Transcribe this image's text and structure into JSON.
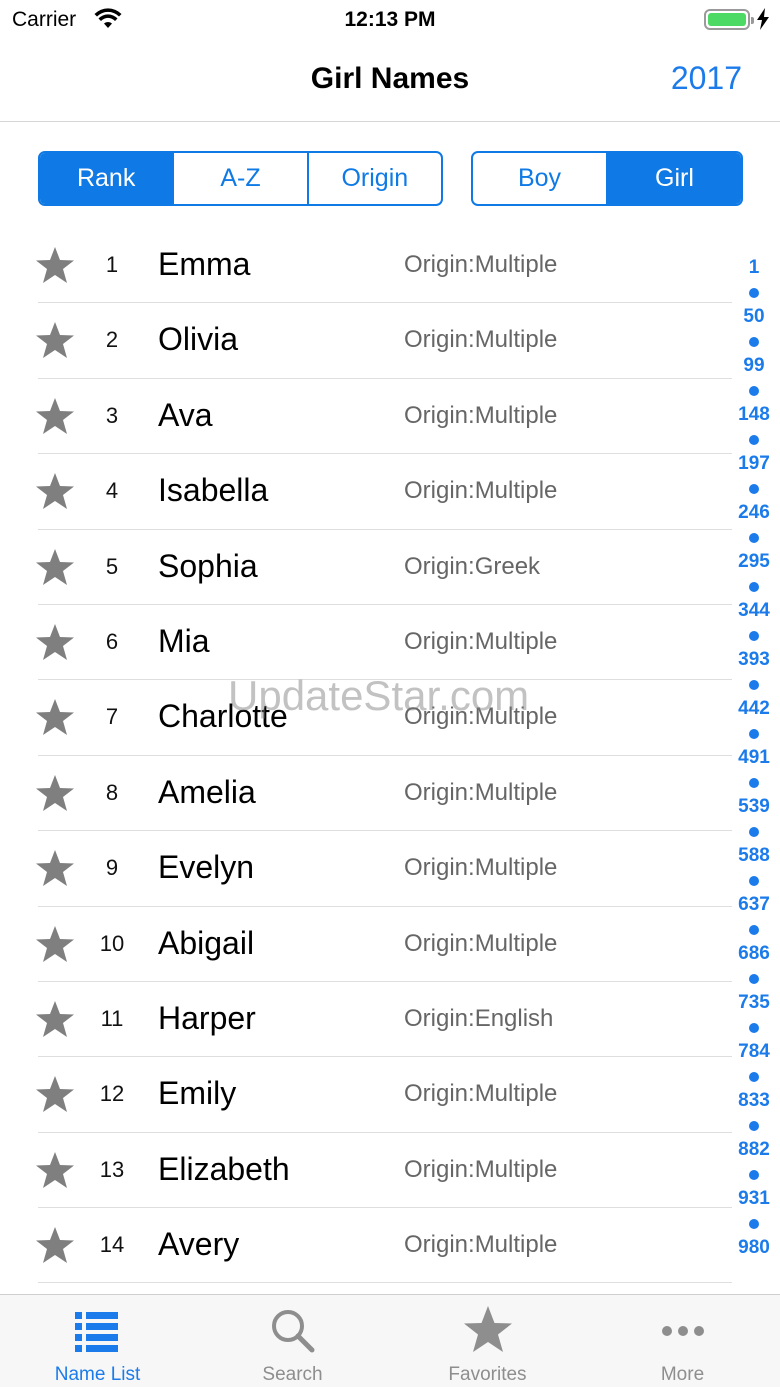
{
  "status_bar": {
    "carrier": "Carrier",
    "time": "12:13 PM"
  },
  "nav": {
    "title": "Girl Names",
    "year": "2017"
  },
  "sort_segment": [
    {
      "label": "Rank",
      "active": true
    },
    {
      "label": "A-Z",
      "active": false
    },
    {
      "label": "Origin",
      "active": false
    }
  ],
  "gender_segment": [
    {
      "label": "Boy",
      "active": false
    },
    {
      "label": "Girl",
      "active": true
    }
  ],
  "names": [
    {
      "rank": "1",
      "name": "Emma",
      "origin": "Origin:Multiple"
    },
    {
      "rank": "2",
      "name": "Olivia",
      "origin": "Origin:Multiple"
    },
    {
      "rank": "3",
      "name": "Ava",
      "origin": "Origin:Multiple"
    },
    {
      "rank": "4",
      "name": "Isabella",
      "origin": "Origin:Multiple"
    },
    {
      "rank": "5",
      "name": "Sophia",
      "origin": "Origin:Greek"
    },
    {
      "rank": "6",
      "name": "Mia",
      "origin": "Origin:Multiple"
    },
    {
      "rank": "7",
      "name": "Charlotte",
      "origin": "Origin:Multiple"
    },
    {
      "rank": "8",
      "name": "Amelia",
      "origin": "Origin:Multiple"
    },
    {
      "rank": "9",
      "name": "Evelyn",
      "origin": "Origin:Multiple"
    },
    {
      "rank": "10",
      "name": "Abigail",
      "origin": "Origin:Multiple"
    },
    {
      "rank": "11",
      "name": "Harper",
      "origin": "Origin:English"
    },
    {
      "rank": "12",
      "name": "Emily",
      "origin": "Origin:Multiple"
    },
    {
      "rank": "13",
      "name": "Elizabeth",
      "origin": "Origin:Multiple"
    },
    {
      "rank": "14",
      "name": "Avery",
      "origin": "Origin:Multiple"
    }
  ],
  "index": [
    "1",
    "50",
    "99",
    "148",
    "197",
    "246",
    "295",
    "344",
    "393",
    "442",
    "491",
    "539",
    "588",
    "637",
    "686",
    "735",
    "784",
    "833",
    "882",
    "931",
    "980"
  ],
  "watermark": "UpdateStar.com",
  "tabs": [
    {
      "label": "Name List",
      "icon": "list-icon",
      "active": true
    },
    {
      "label": "Search",
      "icon": "search-icon",
      "active": false
    },
    {
      "label": "Favorites",
      "icon": "star-icon",
      "active": false
    },
    {
      "label": "More",
      "icon": "more-icon",
      "active": false
    }
  ],
  "colors": {
    "accent": "#0f7ae5",
    "star": "#7f7f7f",
    "battery": "#4cd964"
  }
}
